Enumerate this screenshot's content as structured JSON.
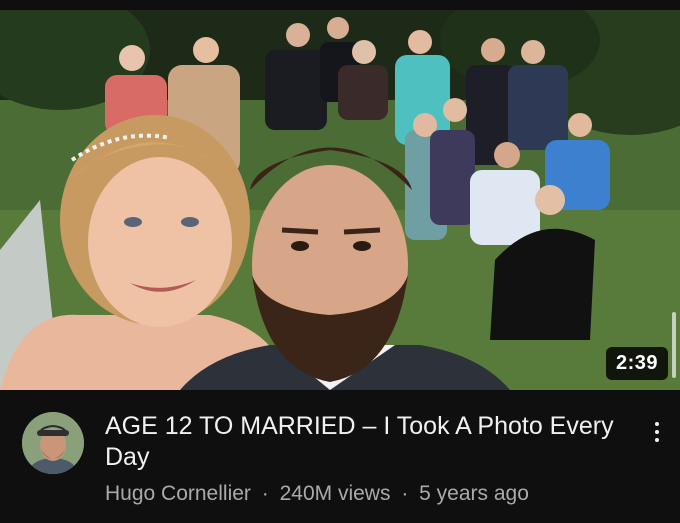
{
  "video": {
    "duration": "2:39",
    "title": "AGE 12 TO MARRIED – I Took A Photo Every Day",
    "channel": "Hugo Cornellier",
    "views": "240M views",
    "age": "5 years ago",
    "separator": "·"
  },
  "icons": {
    "more": "more-vertical-icon",
    "avatar": "channel-avatar"
  }
}
